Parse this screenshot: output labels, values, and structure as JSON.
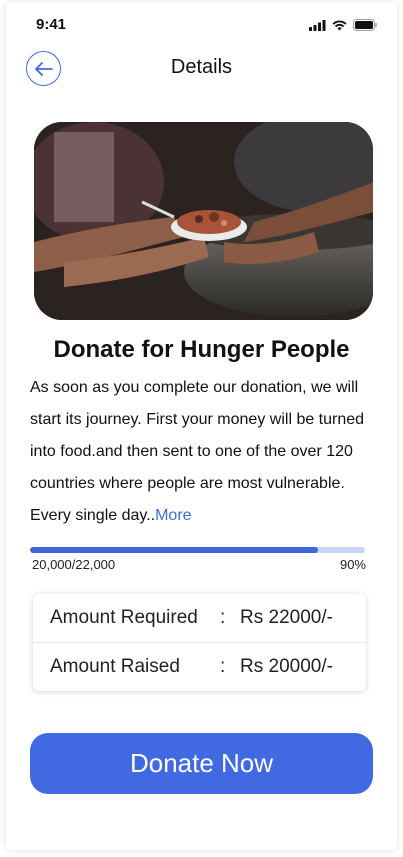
{
  "status_bar": {
    "time": "9:41",
    "icons": [
      "signal-icon",
      "wifi-icon",
      "battery-icon"
    ]
  },
  "header": {
    "title": "Details",
    "back_icon": "arrow-left-icon"
  },
  "hero": {
    "image": "hands-sharing-food-photo"
  },
  "campaign": {
    "title": "Donate for Hunger People",
    "description": "As soon as you complete our donation, we will start its journey. First your money will be turned into food.and then sent to one of the over 120 countries where people are most vulnerable. Every single day..",
    "more_label": "More"
  },
  "progress": {
    "raised_label": "20,000/22,000",
    "percent_label": "90%",
    "fraction": 0.86
  },
  "amounts": {
    "required_label": "Amount Required",
    "required_value": "Rs 22000/-",
    "raised_label": "Amount Raised",
    "raised_value": "Rs 20000/-",
    "separator": ":"
  },
  "donate_button": {
    "label": "Donate Now"
  },
  "colors": {
    "accent": "#4169e1",
    "progress_track": "#c7d4f5",
    "link": "#3b6fd6"
  }
}
